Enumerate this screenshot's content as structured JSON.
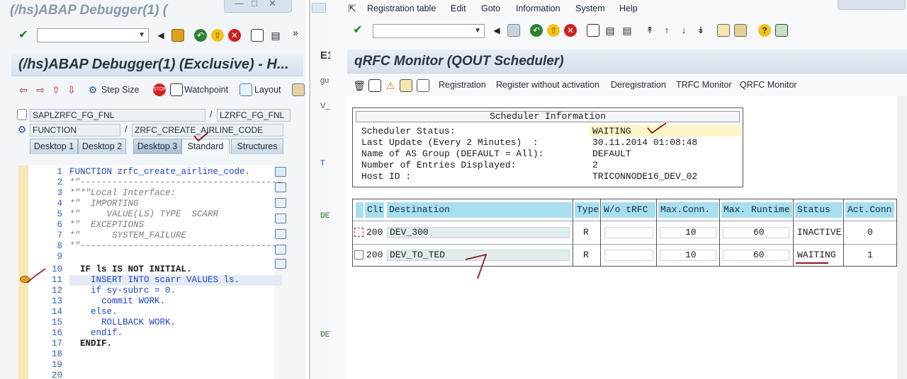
{
  "left_window": {
    "title": "(/hs)ABAP Debugger(1) (",
    "screen_title": "(/hs)ABAP Debugger(1)  (Exclusive) - H...",
    "toolbar": {
      "step_size_label": "Step Size",
      "watchpoint_label": "Watchpoint",
      "layout_label": "Layout"
    },
    "program_field": "SAPLZRFC_FG_FNL",
    "include_field": "LZRFC_FG_FNL",
    "event_type_field": "FUNCTION",
    "event_name_field": "ZRFC_CREATE_AIRLINE_CODE",
    "tabs": [
      "Desktop 1",
      "Desktop 2",
      "Desktop 3",
      "Standard",
      "Structures"
    ],
    "active_tab": "Desktop 3",
    "code_lines": [
      {
        "num": "1",
        "text": "FUNCTION zrfc_create_airline_code."
      },
      {
        "num": "2",
        "text": "*\"--------------------------------------"
      },
      {
        "num": "3",
        "text": "*\"*\"Local Interface:"
      },
      {
        "num": "4",
        "text": "*\"  IMPORTING"
      },
      {
        "num": "5",
        "text": "*\"     VALUE(LS) TYPE  SCARR"
      },
      {
        "num": "6",
        "text": "*\"  EXCEPTIONS"
      },
      {
        "num": "7",
        "text": "*\"      SYSTEM_FAILURE"
      },
      {
        "num": "8",
        "text": "*\"--------------------------------------"
      },
      {
        "num": "9",
        "text": ""
      },
      {
        "num": "10",
        "text": "  IF ls IS NOT INITIAL."
      },
      {
        "num": "11",
        "text": "    INSERT INTO scarr VALUES ls."
      },
      {
        "num": "12",
        "text": "    if sy-subrc = 0."
      },
      {
        "num": "13",
        "text": "      commit WORK."
      },
      {
        "num": "14",
        "text": "    else."
      },
      {
        "num": "15",
        "text": "      ROLLBACK WORK."
      },
      {
        "num": "16",
        "text": "    endif."
      },
      {
        "num": "17",
        "text": "  ENDIF."
      },
      {
        "num": "18",
        "text": ""
      },
      {
        "num": "19",
        "text": ""
      },
      {
        "num": "20",
        "text": ""
      }
    ],
    "current_line": "11"
  },
  "middle_strip": {
    "fragments": [
      "E1",
      "gu",
      "V_",
      "T",
      "DEV",
      "DEV"
    ]
  },
  "right_window": {
    "menu": [
      "Registration table",
      "Edit",
      "Goto",
      "Information",
      "System",
      "Help"
    ],
    "screen_title": "qRFC Monitor (QOUT Scheduler)",
    "app_toolbar": [
      "Registration",
      "Register without activation",
      "Deregistration",
      "TRFC Monitor",
      "QRFC Monitor"
    ],
    "scheduler_info": {
      "title": "Scheduler Information",
      "rows": [
        {
          "label": "Scheduler Status:",
          "value": "WAITING"
        },
        {
          "label": "Last Update (Every 2 Minutes)  :",
          "value": "30.11.2014 01:08:48"
        },
        {
          "label": "Name of AS Group (DEFAULT = All):",
          "value": "DEFAULT"
        },
        {
          "label": "Number of Entries Displayed:",
          "value": "2"
        },
        {
          "label": "Host ID :",
          "value": "TRICONNODE16_DEV_02"
        }
      ]
    },
    "table": {
      "headers": [
        "Clt",
        "Destination",
        "Type",
        "W/o tRFC",
        "Max.Conn.",
        "Max. Runtime",
        "Status",
        "Act.Conn"
      ],
      "rows": [
        {
          "clt": "200",
          "destination": "DEV_300",
          "type": "R",
          "wo_trfc": "",
          "max_conn": "10",
          "max_runtime": "60",
          "status": "INACTIVE",
          "act_conn": "0"
        },
        {
          "clt": "200",
          "destination": "DEV_TO_TED",
          "type": "R",
          "wo_trfc": "",
          "max_conn": "10",
          "max_runtime": "60",
          "status": "WAITING",
          "act_conn": "1"
        }
      ]
    }
  },
  "colors": {
    "table_header": "#a8dff0",
    "keyword": "#1e44c8",
    "annotation": "#8b1a1a",
    "waiting_highlight": "#fbf5c8"
  }
}
